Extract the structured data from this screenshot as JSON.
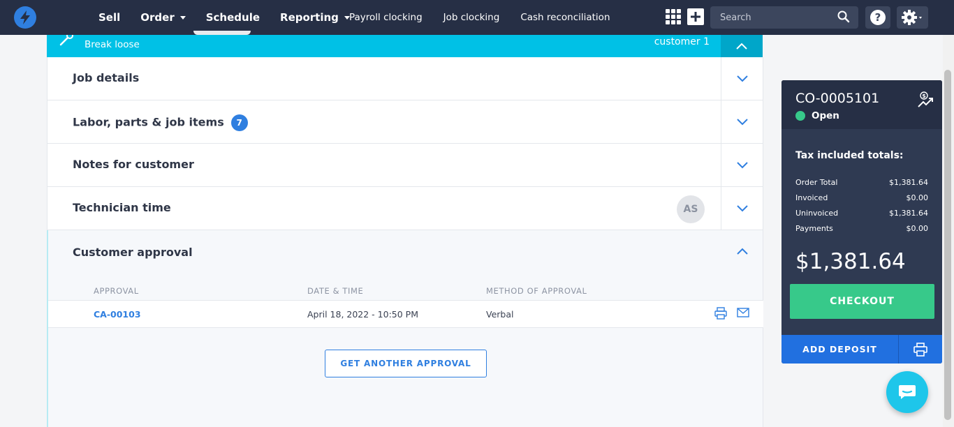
{
  "nav": {
    "main": [
      {
        "label": "Sell",
        "caret": false
      },
      {
        "label": "Order",
        "caret": true
      },
      {
        "label": "Schedule",
        "caret": false
      },
      {
        "label": "Reporting",
        "caret": true
      }
    ],
    "sub": [
      "Payroll clocking",
      "Job clocking",
      "Cash reconciliation"
    ],
    "search_placeholder": "Search"
  },
  "banner": {
    "title": "Break loose",
    "right_text": "customer 1"
  },
  "sections": [
    {
      "label": "Job details"
    },
    {
      "label": "Labor, parts & job items",
      "badge": "7"
    },
    {
      "label": "Notes for customer"
    },
    {
      "label": "Technician time",
      "avatar": "AS"
    }
  ],
  "approval": {
    "title": "Customer approval",
    "columns": [
      "APPROVAL",
      "DATE & TIME",
      "METHOD OF APPROVAL"
    ],
    "rows": [
      {
        "id": "CA-00103",
        "datetime": "April 18, 2022 - 10:50 PM",
        "method": "Verbal"
      }
    ],
    "button": "GET ANOTHER APPROVAL"
  },
  "order": {
    "number": "CO-0005101",
    "status": "Open",
    "status_color": "#37c98a",
    "tax_title": "Tax included totals:",
    "totals": [
      {
        "label": "Order Total",
        "value": "$1,381.64"
      },
      {
        "label": "Invoiced",
        "value": "$0.00"
      },
      {
        "label": "Uninvoiced",
        "value": "$1,381.64"
      },
      {
        "label": "Payments",
        "value": "$0.00"
      }
    ],
    "big_total": "$1,381.64",
    "checkout": "CHECKOUT",
    "add_deposit": "ADD DEPOSIT"
  },
  "colors": {
    "nav_bg": "#262f45",
    "accent_blue": "#2f7fe0",
    "banner_cyan": "#00c1e6",
    "checkout_green": "#37c98a"
  }
}
